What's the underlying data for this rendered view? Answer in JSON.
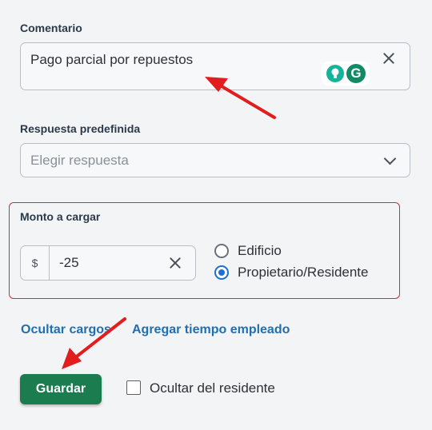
{
  "comment": {
    "label": "Comentario",
    "value": "Pago parcial por repuestos"
  },
  "predefined_response": {
    "label": "Respuesta predefinida",
    "placeholder": "Elegir respuesta"
  },
  "charge": {
    "label": "Monto a cargar",
    "currency_symbol": "$",
    "amount": "-25",
    "options": [
      {
        "label": "Edificio",
        "selected": false
      },
      {
        "label": "Propietario/Residente",
        "selected": true
      }
    ]
  },
  "links": {
    "hide_charges": "Ocultar cargos",
    "add_time": "Agregar tiempo empleado"
  },
  "actions": {
    "save": "Guardar",
    "hide_from_resident": "Ocultar del residente"
  },
  "colors": {
    "annotation_arrow": "#e11d1d",
    "highlight_border": "#d42a35",
    "save_button": "#1b7d4f",
    "link": "#1f6fb3"
  }
}
